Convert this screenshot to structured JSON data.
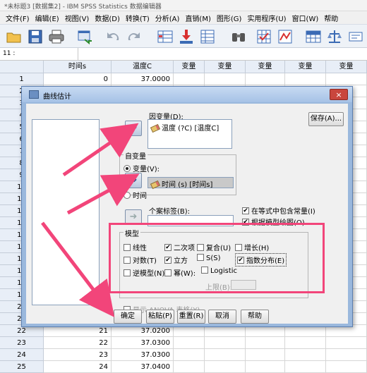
{
  "window": {
    "title": "*未标题3 [数据集2] - IBM SPSS Statistics 数据编辑器"
  },
  "menu": [
    "文件(F)",
    "编辑(E)",
    "视图(V)",
    "数据(D)",
    "转换(T)",
    "分析(A)",
    "直销(M)",
    "图形(G)",
    "实用程序(U)",
    "窗口(W)",
    "帮助"
  ],
  "toolbar_icons": [
    "open-icon",
    "save-icon",
    "print-icon",
    "dialog-recall-icon",
    "undo-icon",
    "redo-icon",
    "goto-case-icon",
    "goto-variable-icon",
    "variables-icon",
    "find-icon",
    "insert-cases-icon",
    "insert-variable-icon",
    "split-file-icon",
    "weight-cases-icon"
  ],
  "cell_address": "11 :",
  "grid": {
    "columns": [
      "时间s",
      "温度C",
      "变量",
      "变量",
      "变量",
      "变量",
      "变量"
    ],
    "rows": [
      {
        "n": "1",
        "v1": "0",
        "v2": "37.0000"
      },
      {
        "n": "2",
        "v1": "",
        "v2": ""
      },
      {
        "n": "3",
        "v1": "",
        "v2": ""
      },
      {
        "n": "4",
        "v1": "",
        "v2": ""
      },
      {
        "n": "5",
        "v1": "",
        "v2": ""
      },
      {
        "n": "6",
        "v1": "",
        "v2": ""
      },
      {
        "n": "7",
        "v1": "",
        "v2": ""
      },
      {
        "n": "8",
        "v1": "",
        "v2": ""
      },
      {
        "n": "9",
        "v1": "",
        "v2": ""
      },
      {
        "n": "10",
        "v1": "",
        "v2": ""
      },
      {
        "n": "11",
        "v1": "",
        "v2": ""
      },
      {
        "n": "12",
        "v1": "",
        "v2": ""
      },
      {
        "n": "13",
        "v1": "",
        "v2": ""
      },
      {
        "n": "14",
        "v1": "",
        "v2": ""
      },
      {
        "n": "15",
        "v1": "",
        "v2": ""
      },
      {
        "n": "16",
        "v1": "",
        "v2": ""
      },
      {
        "n": "17",
        "v1": "",
        "v2": ""
      },
      {
        "n": "18",
        "v1": "",
        "v2": ""
      },
      {
        "n": "19",
        "v1": "",
        "v2": ""
      },
      {
        "n": "20",
        "v1": "",
        "v2": ""
      },
      {
        "n": "21",
        "v1": "",
        "v2": ""
      },
      {
        "n": "22",
        "v1": "21",
        "v2": "37.0200"
      },
      {
        "n": "23",
        "v1": "22",
        "v2": "37.0300"
      },
      {
        "n": "24",
        "v1": "23",
        "v2": "37.0300"
      },
      {
        "n": "25",
        "v1": "24",
        "v2": "37.0400"
      }
    ]
  },
  "dialog": {
    "title": "曲线估计",
    "dependent_label": "因变量(D):",
    "dependent_value": "温度 (?C) [温度C]",
    "save_button": "保存(A)...",
    "independent_group": "自变量",
    "radio_variable": "变量(V):",
    "independent_value": "时间 (s) [时间s]",
    "radio_time": "时间",
    "case_label": "个案标签(B):",
    "include_constant": "在等式中包含常量(I)",
    "plot_models": "根据模型绘图(O)",
    "models_group": "模型",
    "models": {
      "linear": "线性",
      "quadratic": "二次项",
      "compound": "复合(U)",
      "growth": "增长(H)",
      "logarithmic": "对数(T)",
      "cubic": "立方",
      "s": "S(S)",
      "exponential": "指数分布(E)",
      "inverse": "逆模型(N)",
      "power": "幂(W):",
      "logistic": "Logistic",
      "upper_bound": "上限(B):"
    },
    "anova_label": "显示 ANOVA 表格(Y)",
    "buttons": {
      "ok": "确定",
      "paste": "粘贴(P)",
      "reset": "重置(R)",
      "cancel": "取消",
      "help": "帮助"
    },
    "close": "×"
  },
  "colors": {
    "highlight": "#f2457a",
    "dialog_frame": "#9ab8dd"
  }
}
